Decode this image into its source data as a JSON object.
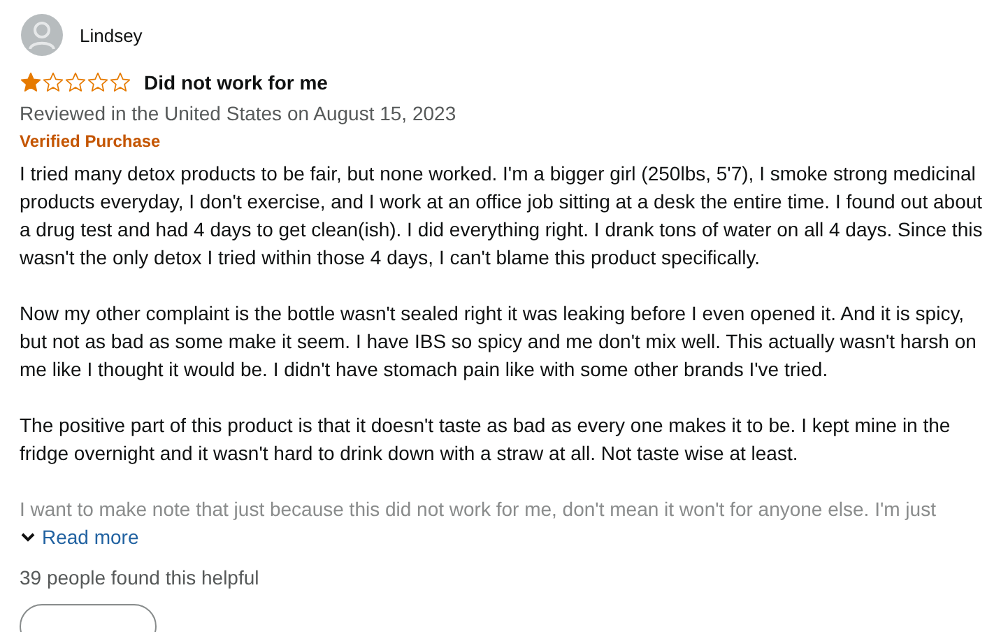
{
  "reviewer": {
    "name": "Lindsey"
  },
  "review": {
    "stars": 1,
    "title": "Did not work for me",
    "meta": "Reviewed in the United States on August 15, 2023",
    "badge": "Verified Purchase",
    "paragraphs": [
      "I tried many detox products to be fair, but none worked. I'm a bigger girl (250lbs, 5'7), I smoke strong medicinal products everyday, I don't exercise, and I work at an office job sitting at a desk the entire time. I found out about a drug test and had 4 days to get clean(ish). I did everything right. I drank tons of water on all 4 days. Since this wasn't the only detox I tried within those 4 days, I can't blame this product specifically.",
      "Now my other complaint is the bottle wasn't sealed right it was leaking before I even opened it. And it is spicy, but not as bad as some make it seem. I have IBS so spicy and me don't mix well. This actually wasn't harsh on me like I thought it would be. I didn't have stomach pain like with some other brands I've tried.",
      "The positive part of this product is that it doesn't taste as bad as every one makes it to be. I kept mine in the fridge overnight and it wasn't hard to drink down with a straw at all. Not taste wise at least."
    ],
    "faded_line": "I want to make note that just because this did not work for me, don't mean it won't for anyone else. I'm just",
    "read_more": "Read more",
    "helpful_count": "39 people found this helpful"
  }
}
